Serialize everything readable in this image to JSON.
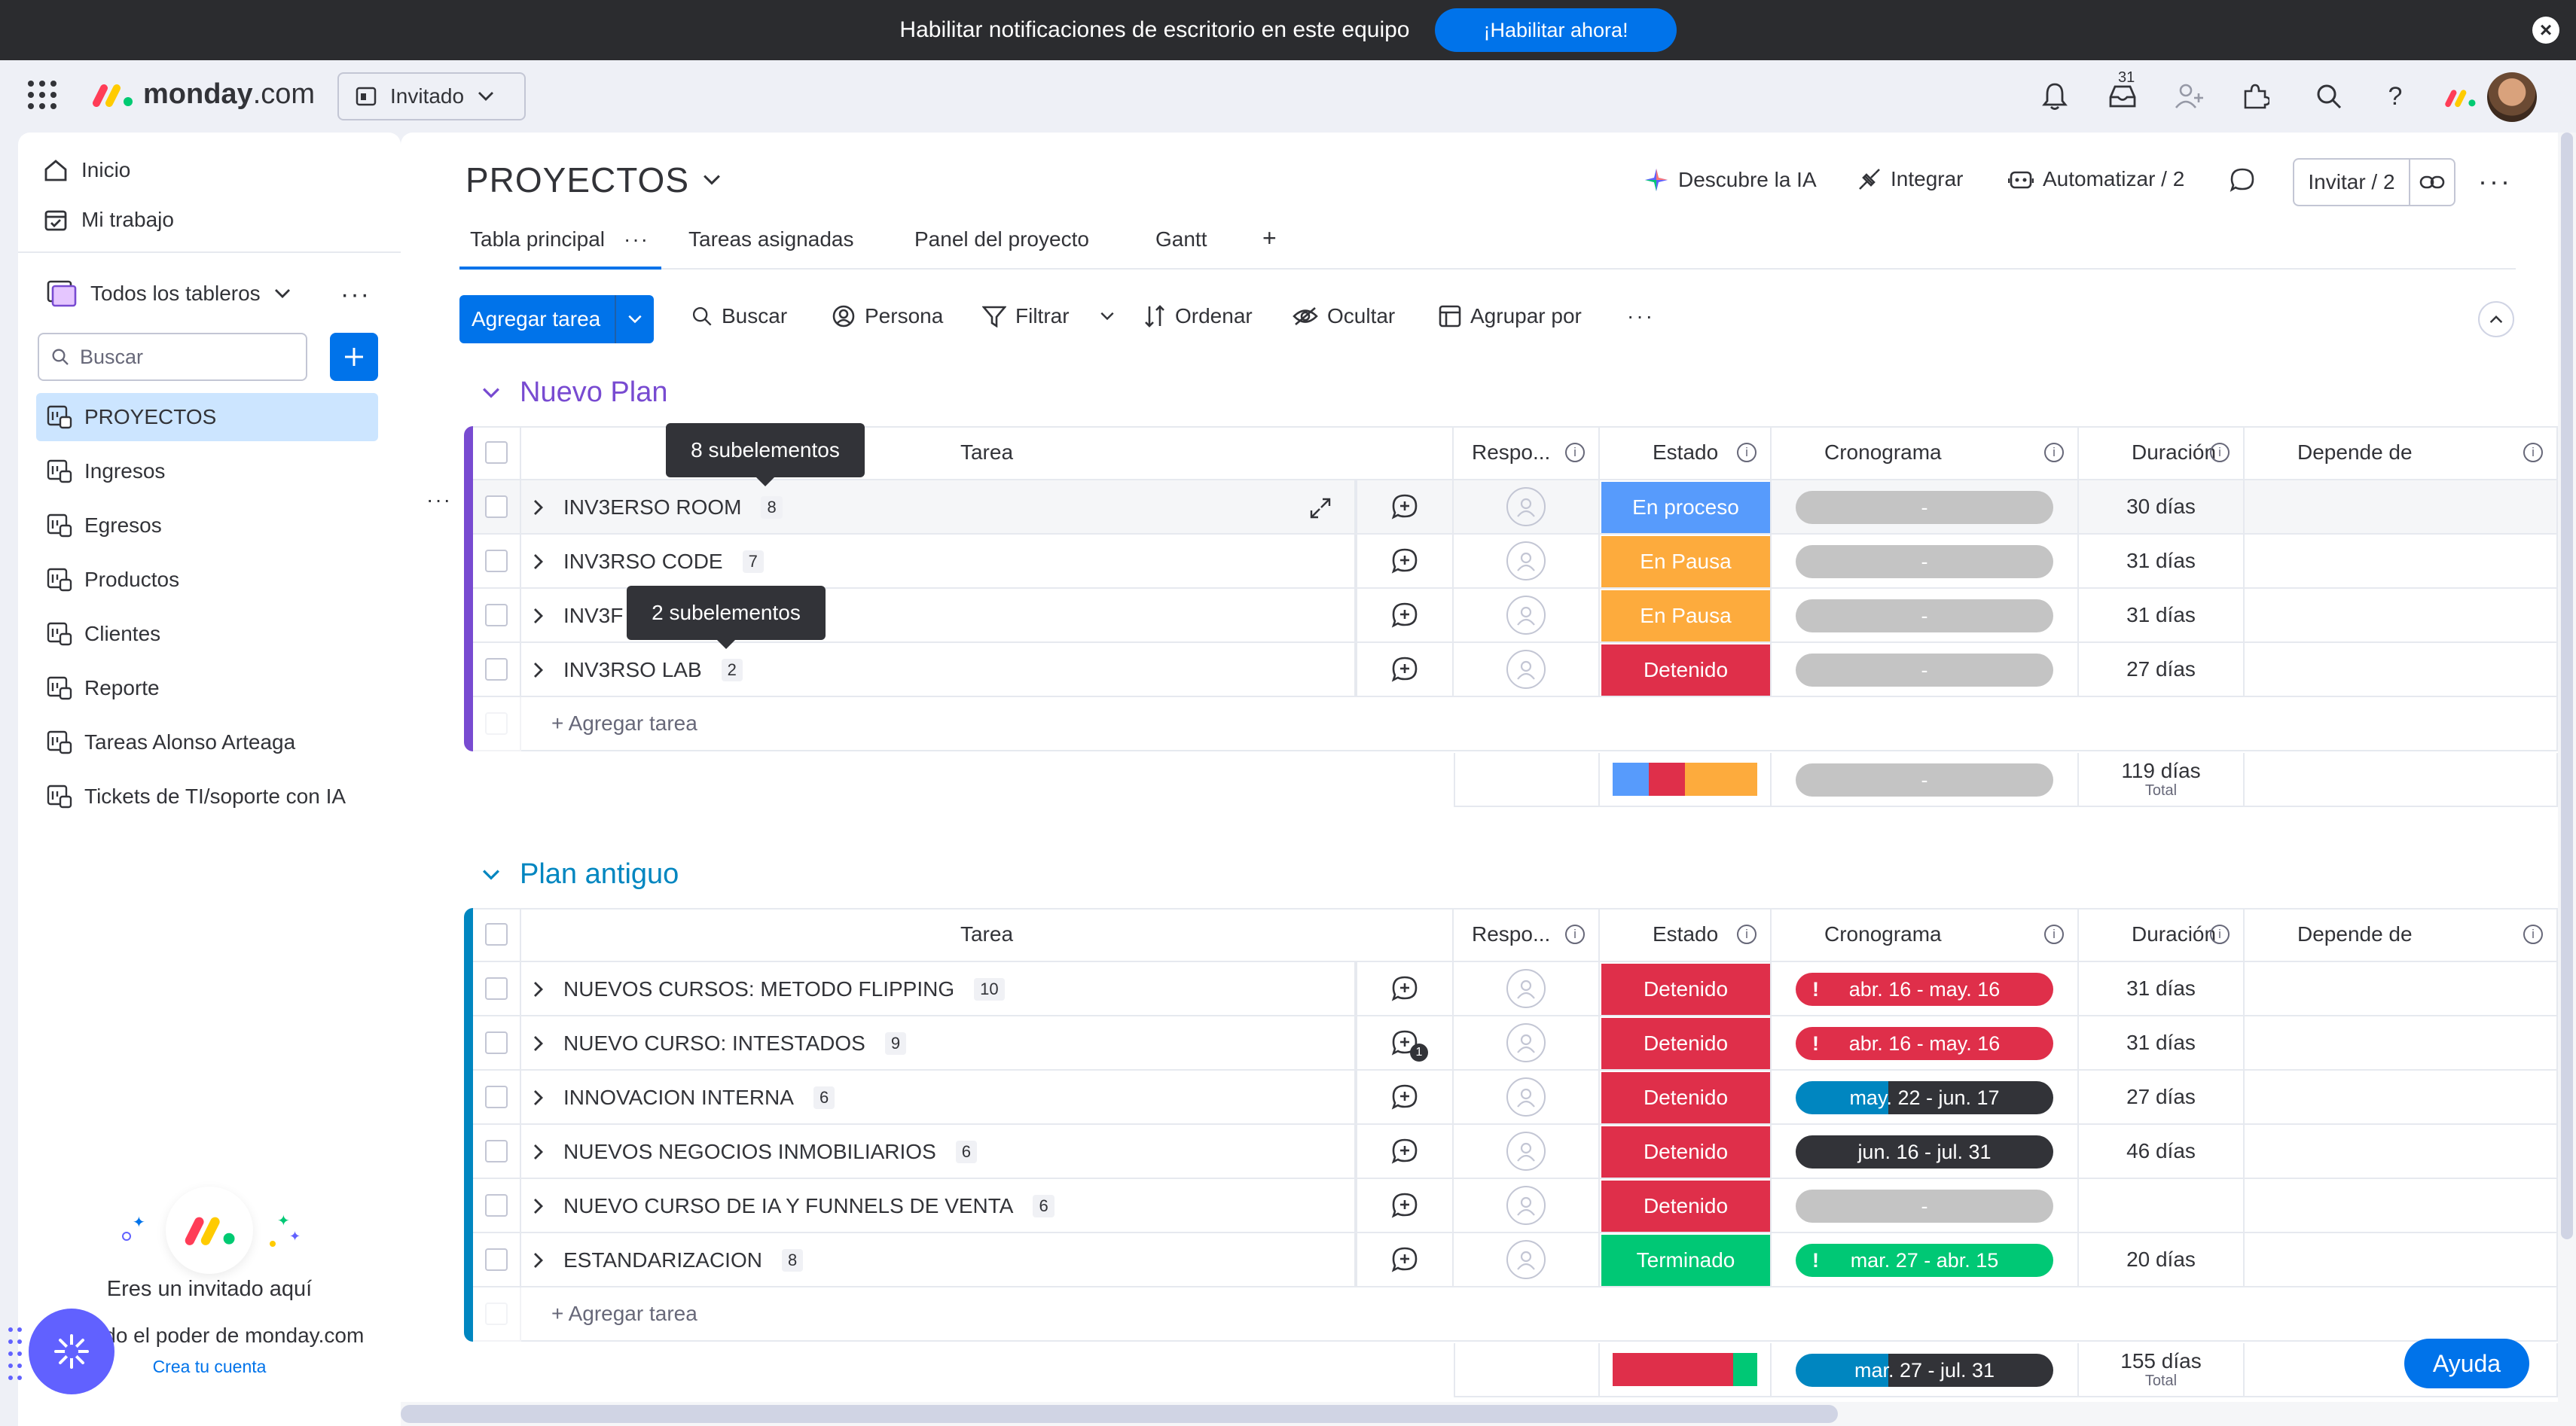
{
  "notification": {
    "message": "Habilitar notificaciones de escritorio en este equipo",
    "cta": "¡Habilitar ahora!"
  },
  "topbar": {
    "brand_main": "monday",
    "brand_suffix": ".com",
    "guest_label": "Invitado",
    "inbox_count": "31"
  },
  "sidebar": {
    "top_items": [
      {
        "label": "Inicio",
        "icon": "home-icon"
      },
      {
        "label": "Mi trabajo",
        "icon": "calendar-check-icon"
      }
    ],
    "boards_label": "Todos los tableros",
    "search_placeholder": "Buscar",
    "boards": [
      {
        "label": "PROYECTOS",
        "active": true
      },
      {
        "label": "Ingresos"
      },
      {
        "label": "Egresos"
      },
      {
        "label": "Productos"
      },
      {
        "label": "Clientes"
      },
      {
        "label": "Reporte"
      },
      {
        "label": "Tareas Alonso Arteaga"
      },
      {
        "label": "Tickets de TI/soporte con IA"
      }
    ],
    "guest_title": "Eres un invitado aquí",
    "guest_subtitle": "odo el poder de monday.com",
    "guest_link": "Crea tu cuenta"
  },
  "board": {
    "title": "PROYECTOS",
    "actions": {
      "ai": "Descubre la IA",
      "integrate": "Integrar",
      "automate": "Automatizar / 2",
      "invite": "Invitar / 2"
    },
    "tabs": [
      "Tabla principal",
      "Tareas asignadas",
      "Panel del proyecto",
      "Gantt"
    ],
    "tab_add": "+",
    "toolbar": {
      "add_task": "Agregar tarea",
      "search": "Buscar",
      "person": "Persona",
      "filter": "Filtrar",
      "sort": "Ordenar",
      "hide": "Ocultar",
      "group_by": "Agrupar por"
    },
    "columns": {
      "task": "Tarea",
      "owner": "Respo...",
      "status": "Estado",
      "timeline": "Cronograma",
      "duration": "Duración",
      "depends": "Depende de"
    },
    "add_task_row": "+ Agregar tarea",
    "total_label": "Total",
    "colors": {
      "in_progress": "#579bfc",
      "paused": "#fdab3d",
      "stopped": "#df2f4a",
      "done": "#00c875",
      "group1": "#784bd1",
      "group2": "#0086c0"
    },
    "groups": [
      {
        "title": "Nuevo Plan",
        "rows": [
          {
            "name": "INV3ERSO ROOM",
            "count": "8",
            "status": "En proceso",
            "status_key": "in_progress",
            "timeline": "-",
            "timeline_type": "empty",
            "duration": "30 días"
          },
          {
            "name": "INV3RSO CODE",
            "count": "7",
            "status": "En Pausa",
            "status_key": "paused",
            "timeline": "-",
            "timeline_type": "empty",
            "duration": "31 días"
          },
          {
            "name": "INV3F",
            "count": "",
            "status": "En Pausa",
            "status_key": "paused",
            "timeline": "-",
            "timeline_type": "empty",
            "duration": "31 días"
          },
          {
            "name": "INV3RSO LAB",
            "count": "2",
            "status": "Detenido",
            "status_key": "stopped",
            "timeline": "-",
            "timeline_type": "empty",
            "duration": "27 días"
          }
        ],
        "summary_timeline": "-",
        "summary_duration": "119 días",
        "tooltips": [
          "8 subelementos",
          "2 subelementos"
        ]
      },
      {
        "title": "Plan antiguo",
        "rows": [
          {
            "name": "NUEVOS CURSOS: METODO FLIPPING",
            "count": "10",
            "status": "Detenido",
            "status_key": "stopped",
            "timeline": "abr. 16 - may. 16",
            "timeline_type": "overdue",
            "duration": "31 días"
          },
          {
            "name": "NUEVO CURSO: INTESTADOS",
            "count": "9",
            "status": "Detenido",
            "status_key": "stopped",
            "timeline": "abr. 16 - may. 16",
            "timeline_type": "overdue",
            "duration": "31 días",
            "comment_badge": "1"
          },
          {
            "name": "INNOVACION INTERNA",
            "count": "6",
            "status": "Detenido",
            "status_key": "stopped",
            "timeline": "may. 22 - jun. 17",
            "timeline_type": "partial",
            "duration": "27 días"
          },
          {
            "name": "NUEVOS NEGOCIOS INMOBILIARIOS",
            "count": "6",
            "status": "Detenido",
            "status_key": "stopped",
            "timeline": "jun. 16 - jul. 31",
            "timeline_type": "future",
            "duration": "46 días"
          },
          {
            "name": "NUEVO CURSO DE IA Y FUNNELS DE VENTA",
            "count": "6",
            "status": "Detenido",
            "status_key": "stopped",
            "timeline": "-",
            "timeline_type": "empty",
            "duration": ""
          },
          {
            "name": "ESTANDARIZACION",
            "count": "8",
            "status": "Terminado",
            "status_key": "done",
            "timeline": "mar. 27 - abr. 15",
            "timeline_type": "done_overdue",
            "duration": "20 días"
          }
        ],
        "summary_timeline": "mar. 27 - jul. 31",
        "summary_duration": "155 días"
      }
    ],
    "help": "Ayuda"
  }
}
